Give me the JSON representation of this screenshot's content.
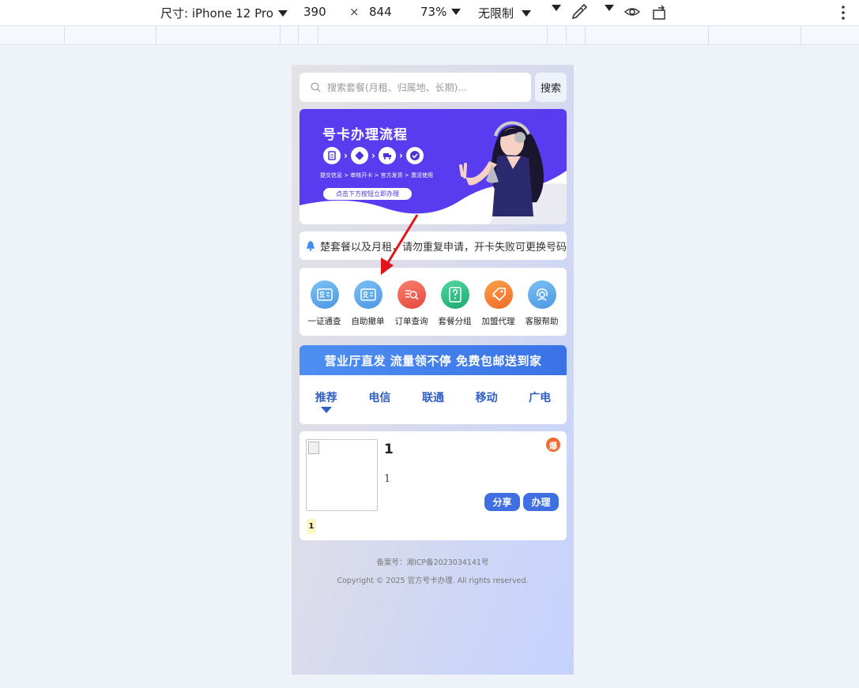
{
  "devtools": {
    "dimensions_label": "尺寸: iPhone 12 Pro",
    "width": "390",
    "times": "×",
    "height": "844",
    "zoom": "73%",
    "throttle": "无限制"
  },
  "search": {
    "placeholder": "搜索套餐(月租、归属地、长期)...",
    "button_label": "搜索"
  },
  "banner": {
    "title": "号卡办理流程",
    "steps_text": "提交信息 > 审核开卡 > 官方发货 > 激活使用",
    "cta_label": "点击下方按钮立即办理"
  },
  "notice": {
    "text": "楚套餐以及月租，请勿重复申请，开卡失败可更换号码"
  },
  "grid": {
    "items": [
      {
        "label": "一证通查",
        "icon": "id-card-icon",
        "color": "#5aa8ec"
      },
      {
        "label": "自助撤单",
        "icon": "id-card-icon",
        "color": "#5aa8ec"
      },
      {
        "label": "订单查询",
        "icon": "search-doc-icon",
        "color": "#ee5a4a"
      },
      {
        "label": "套餐分组",
        "icon": "question-doc-icon",
        "color": "#2cbf84"
      },
      {
        "label": "加盟代理",
        "icon": "tag-icon",
        "color": "#f0782e"
      },
      {
        "label": "客服帮助",
        "icon": "headset-icon",
        "color": "#5aa8ec"
      }
    ]
  },
  "promo": {
    "headline": "营业厅直发 流量领不停 免费包邮送到家",
    "tabs": [
      "推荐",
      "电信",
      "联通",
      "移动",
      "广电"
    ]
  },
  "product": {
    "title": "1",
    "description": "1",
    "hot_badge": "爆",
    "share_label": "分享",
    "apply_label": "办理",
    "tag": "1"
  },
  "footer": {
    "icp": "备案号：湘ICP备2023034141号",
    "copyright": "Copyright © 2025 官方号卡办理. All rights reserved."
  }
}
